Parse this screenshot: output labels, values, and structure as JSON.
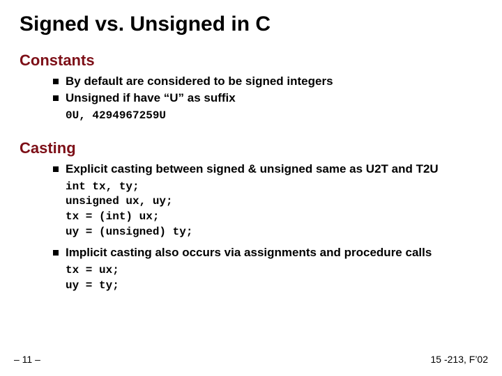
{
  "title": "Signed vs. Unsigned in C",
  "sections": {
    "constants": {
      "head": "Constants",
      "b0": "By default are considered to be signed integers",
      "b1": "Unsigned if have “U” as suffix",
      "code0": "0U, 4294967259U"
    },
    "casting": {
      "head": "Casting",
      "b0": "Explicit casting between signed & unsigned same as U2T and T2U",
      "c1l0": "int tx, ty;",
      "c1l1": "unsigned ux, uy;",
      "c1l2": "tx = (int) ux;",
      "c1l3": "uy = (unsigned) ty;",
      "b1": "Implicit casting also occurs via assignments and procedure calls",
      "c2l0": "tx = ux;",
      "c2l1": "uy = ty;"
    }
  },
  "footer": {
    "left": "– 11 –",
    "right": "15 -213, F’02"
  }
}
